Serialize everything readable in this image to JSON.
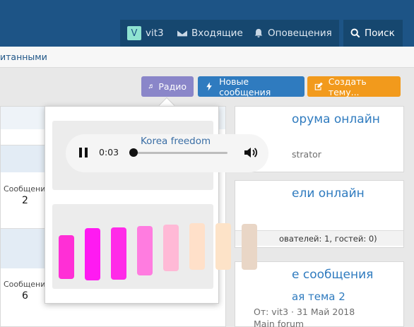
{
  "header": {
    "user": "vit3",
    "user_initial": "V",
    "inbox_label": "Входящие",
    "alerts_label": "Оповещения",
    "search_label": "Поиск"
  },
  "subnav": {
    "link_text": "итанными"
  },
  "actions": {
    "radio_label": "Радио",
    "new_posts_label": "Новые сообщения",
    "create_topic_label": "Создать тему..."
  },
  "left_list": {
    "rows": [
      {
        "label": "Сообщени",
        "value": "2"
      },
      {
        "label": "Сообщени",
        "value": "6"
      }
    ]
  },
  "right_widgets": {
    "online_staff_title": "орума онлайн",
    "online_staff_sub": "strator",
    "online_users_title": "ели онлайн",
    "online_users_footer": "ователей: 1, гостей: 0)",
    "latest_posts_title": "е сообщения",
    "latest_post_title": "ая тема 2",
    "latest_post_meta": "От: vit3 · 31 Май 2018",
    "latest_post_forum": "Main forum"
  },
  "radio_player": {
    "track_title": "Korea freedom",
    "elapsed": "0:03",
    "progress_fraction": 0.0,
    "state": "playing"
  },
  "palette": {
    "swatches": [
      "#ff2fd6",
      "#ff1af2",
      "#ff2be8",
      "#ff7ce0",
      "#ffb9d6",
      "#ffe0c9",
      "#fde3c8",
      "#e9d6c6"
    ]
  },
  "colors": {
    "header_bg": "#1d5486",
    "radio_btn": "#8a86c9",
    "new_posts_btn": "#2f7bbf",
    "create_btn": "#f29a1c",
    "link": "#2f7bbf"
  }
}
